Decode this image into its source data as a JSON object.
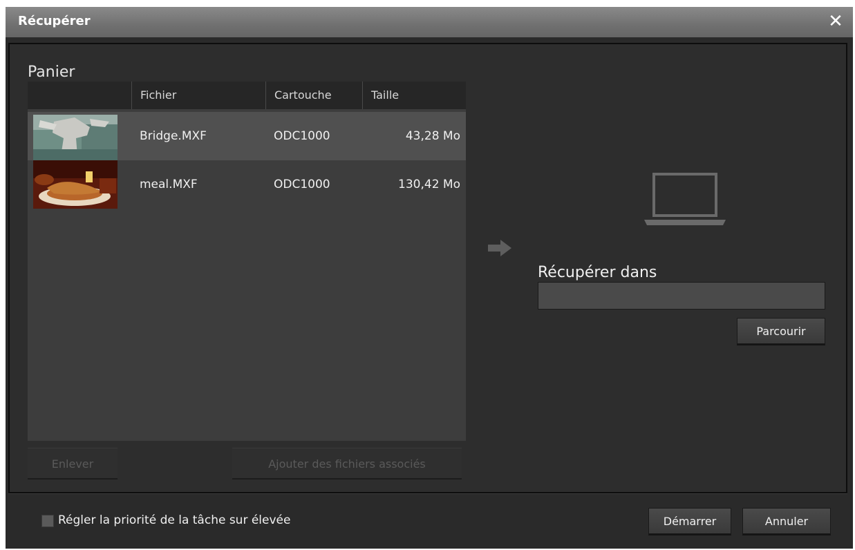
{
  "window": {
    "title": "Récupérer",
    "close_glyph": "✕"
  },
  "basket": {
    "label": "Panier",
    "columns": [
      "Fichier",
      "Cartouche",
      "Taille"
    ],
    "rows": [
      {
        "file": "Bridge.MXF",
        "cartridge": "ODC1000",
        "size": "43,28 Mo",
        "thumbnail": "bridge-thumbnail",
        "selected": true
      },
      {
        "file": "meal.MXF",
        "cartridge": "ODC1000",
        "size": "130,42 Mo",
        "thumbnail": "meal-thumbnail",
        "selected": false
      }
    ],
    "remove_label": "Enlever",
    "add_associated_label": "Ajouter des fichiers associés"
  },
  "destination": {
    "label": "Récupérer dans",
    "path_value": "",
    "browse_label": "Parcourir"
  },
  "footer": {
    "priority_checkbox_label": "Régler la priorité de la tâche sur élevée",
    "priority_checked": false,
    "start_label": "Démarrer",
    "cancel_label": "Annuler"
  },
  "icons": {
    "arrow": "arrow-right-icon",
    "laptop": "laptop-icon"
  }
}
